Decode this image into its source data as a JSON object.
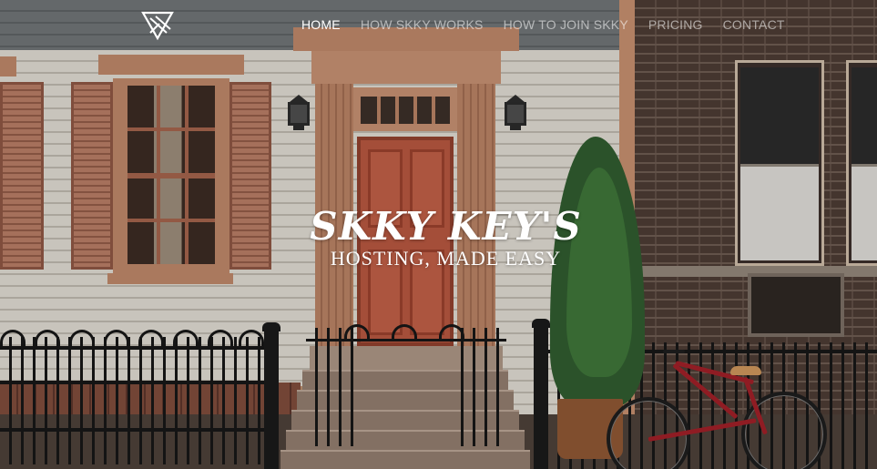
{
  "nav": {
    "items": [
      {
        "label": "HOME",
        "active": true
      },
      {
        "label": "HOW SKKY WORKS",
        "active": false
      },
      {
        "label": "HOW TO JOIN SKKY",
        "active": false
      },
      {
        "label": "PRICING",
        "active": false
      },
      {
        "label": "CONTACT",
        "active": false
      }
    ],
    "logo_icon": "skky-logo-icon"
  },
  "hero": {
    "title": "SKKY KEY'S",
    "tagline": "HOSTING, MADE EASY"
  },
  "colors": {
    "nav_active": "#ffffff",
    "nav_inactive": "rgba(255,255,255,0.55)",
    "headline": "#ffffff"
  }
}
